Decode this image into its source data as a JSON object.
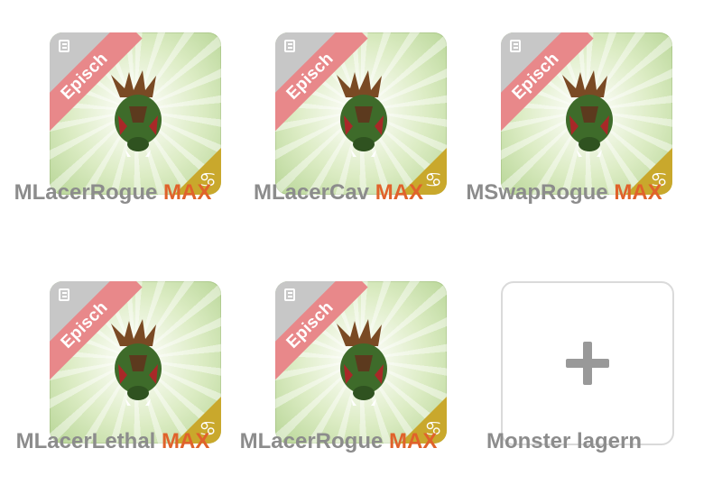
{
  "cards": [
    {
      "name": "MLacerRogue",
      "level": "MAX",
      "rarity": "Episch",
      "sign_icon": "cancer-sign-icon"
    },
    {
      "name": "MLacerCav",
      "level": "MAX",
      "rarity": "Episch",
      "sign_icon": "cancer-sign-icon"
    },
    {
      "name": "MSwapRogue",
      "level": "MAX",
      "rarity": "Episch",
      "sign_icon": "cancer-sign-icon"
    },
    {
      "name": "MLacerLethal",
      "level": "MAX",
      "rarity": "Episch",
      "sign_icon": "cancer-sign-icon"
    },
    {
      "name": "MLacerRogue",
      "level": "MAX",
      "rarity": "Episch",
      "sign_icon": "cancer-sign-icon"
    }
  ],
  "add_slot": {
    "label": "Monster lagern",
    "icon": "plus-icon"
  },
  "colors": {
    "rarity_ribbon": "#e8888a",
    "max_label": "#e0622b",
    "name_text": "#8c8c8c",
    "sign_badge": "#c9a82c",
    "card_background": "#dcecc4"
  }
}
